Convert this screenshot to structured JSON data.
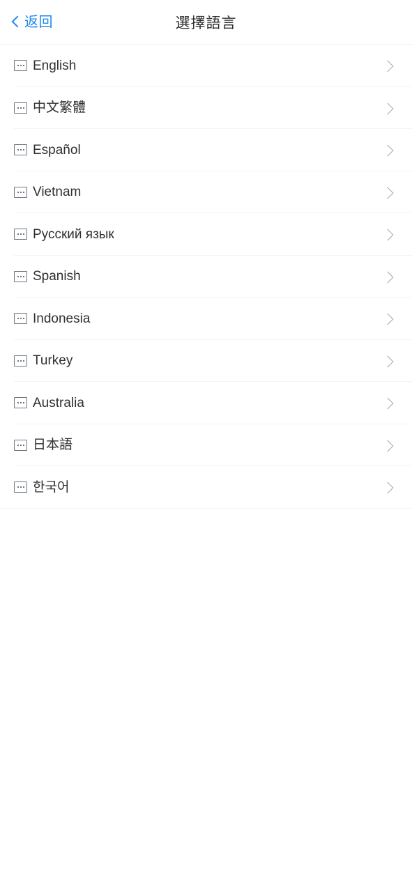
{
  "header": {
    "back_label": "返回",
    "back_icon": "chevron-left-icon",
    "title": "選擇語言",
    "accent_color": "#1e88f0",
    "title_color": "#2e2e2e",
    "border_color": "#f0f0f0"
  },
  "list": {
    "row_icon": "broken-image-placeholder-icon",
    "row_arrow_icon": "chevron-right-icon",
    "separator_color": "#f4f4f5",
    "label_color": "#303030",
    "arrow_color": "#a7a7a7",
    "items": [
      {
        "label": "English"
      },
      {
        "label": "中文繁體"
      },
      {
        "label": "Español"
      },
      {
        "label": "Vietnam"
      },
      {
        "label": "Русский язык"
      },
      {
        "label": "Spanish"
      },
      {
        "label": "Indonesia"
      },
      {
        "label": "Turkey"
      },
      {
        "label": "Australia"
      },
      {
        "label": "日本語"
      },
      {
        "label": "한국어"
      }
    ]
  },
  "page": {
    "background_color": "#ffffff"
  }
}
